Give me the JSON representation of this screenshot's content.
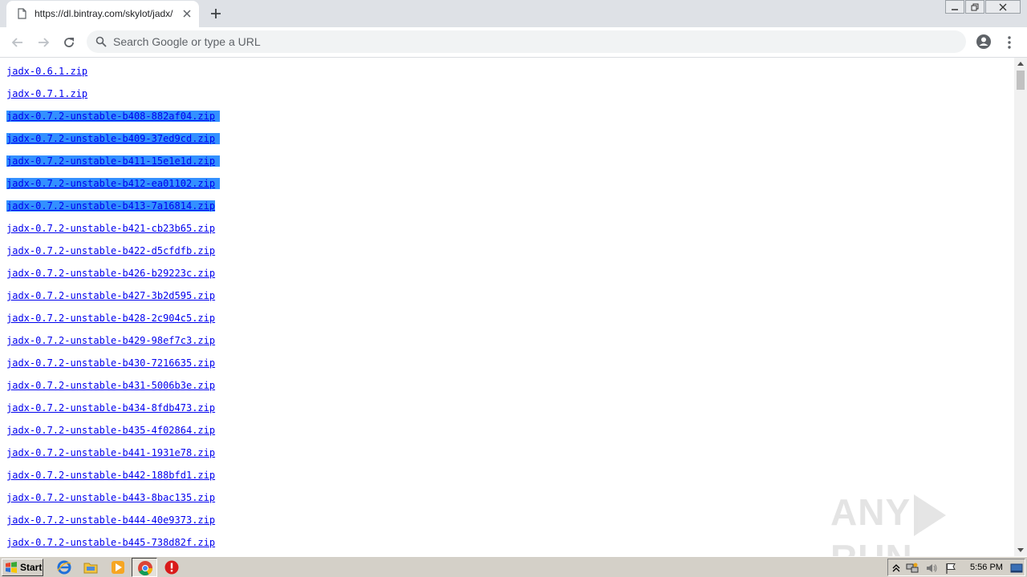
{
  "browser": {
    "tab_title": "https://dl.bintray.com/skylot/jadx/",
    "omnibox_placeholder": "Search Google or type a URL"
  },
  "files": [
    {
      "name": "jadx-0.6.1.zip",
      "selected": false
    },
    {
      "name": "jadx-0.7.1.zip",
      "selected": false
    },
    {
      "name": "jadx-0.7.2-unstable-b408-882af04.zip",
      "selected": true
    },
    {
      "name": "jadx-0.7.2-unstable-b409-37ed9cd.zip",
      "selected": true
    },
    {
      "name": "jadx-0.7.2-unstable-b411-15e1e1d.zip",
      "selected": true
    },
    {
      "name": "jadx-0.7.2-unstable-b412-ea01102.zip",
      "selected": true
    },
    {
      "name": "jadx-0.7.2-unstable-b413-7a16814.zip",
      "selected": true
    },
    {
      "name": "jadx-0.7.2-unstable-b421-cb23b65.zip",
      "selected": false
    },
    {
      "name": "jadx-0.7.2-unstable-b422-d5cfdfb.zip",
      "selected": false
    },
    {
      "name": "jadx-0.7.2-unstable-b426-b29223c.zip",
      "selected": false
    },
    {
      "name": "jadx-0.7.2-unstable-b427-3b2d595.zip",
      "selected": false
    },
    {
      "name": "jadx-0.7.2-unstable-b428-2c904c5.zip",
      "selected": false
    },
    {
      "name": "jadx-0.7.2-unstable-b429-98ef7c3.zip",
      "selected": false
    },
    {
      "name": "jadx-0.7.2-unstable-b430-7216635.zip",
      "selected": false
    },
    {
      "name": "jadx-0.7.2-unstable-b431-5006b3e.zip",
      "selected": false
    },
    {
      "name": "jadx-0.7.2-unstable-b434-8fdb473.zip",
      "selected": false
    },
    {
      "name": "jadx-0.7.2-unstable-b435-4f02864.zip",
      "selected": false
    },
    {
      "name": "jadx-0.7.2-unstable-b441-1931e78.zip",
      "selected": false
    },
    {
      "name": "jadx-0.7.2-unstable-b442-188bfd1.zip",
      "selected": false
    },
    {
      "name": "jadx-0.7.2-unstable-b443-8bac135.zip",
      "selected": false
    },
    {
      "name": "jadx-0.7.2-unstable-b444-40e9373.zip",
      "selected": false
    },
    {
      "name": "jadx-0.7.2-unstable-b445-738d82f.zip",
      "selected": false
    }
  ],
  "watermark": {
    "left": "ANY",
    "right": "RUN"
  },
  "taskbar": {
    "start_label": "Start",
    "clock": "5:56 PM",
    "quick_launch": [
      "ie-icon",
      "explorer-icon",
      "media-player-icon",
      "chrome-icon",
      "stop-icon"
    ]
  },
  "colors": {
    "link": "#0000ee",
    "selection": "#3390ff",
    "tabstrip": "#dee1e6",
    "taskbar": "#d4d0c8"
  }
}
